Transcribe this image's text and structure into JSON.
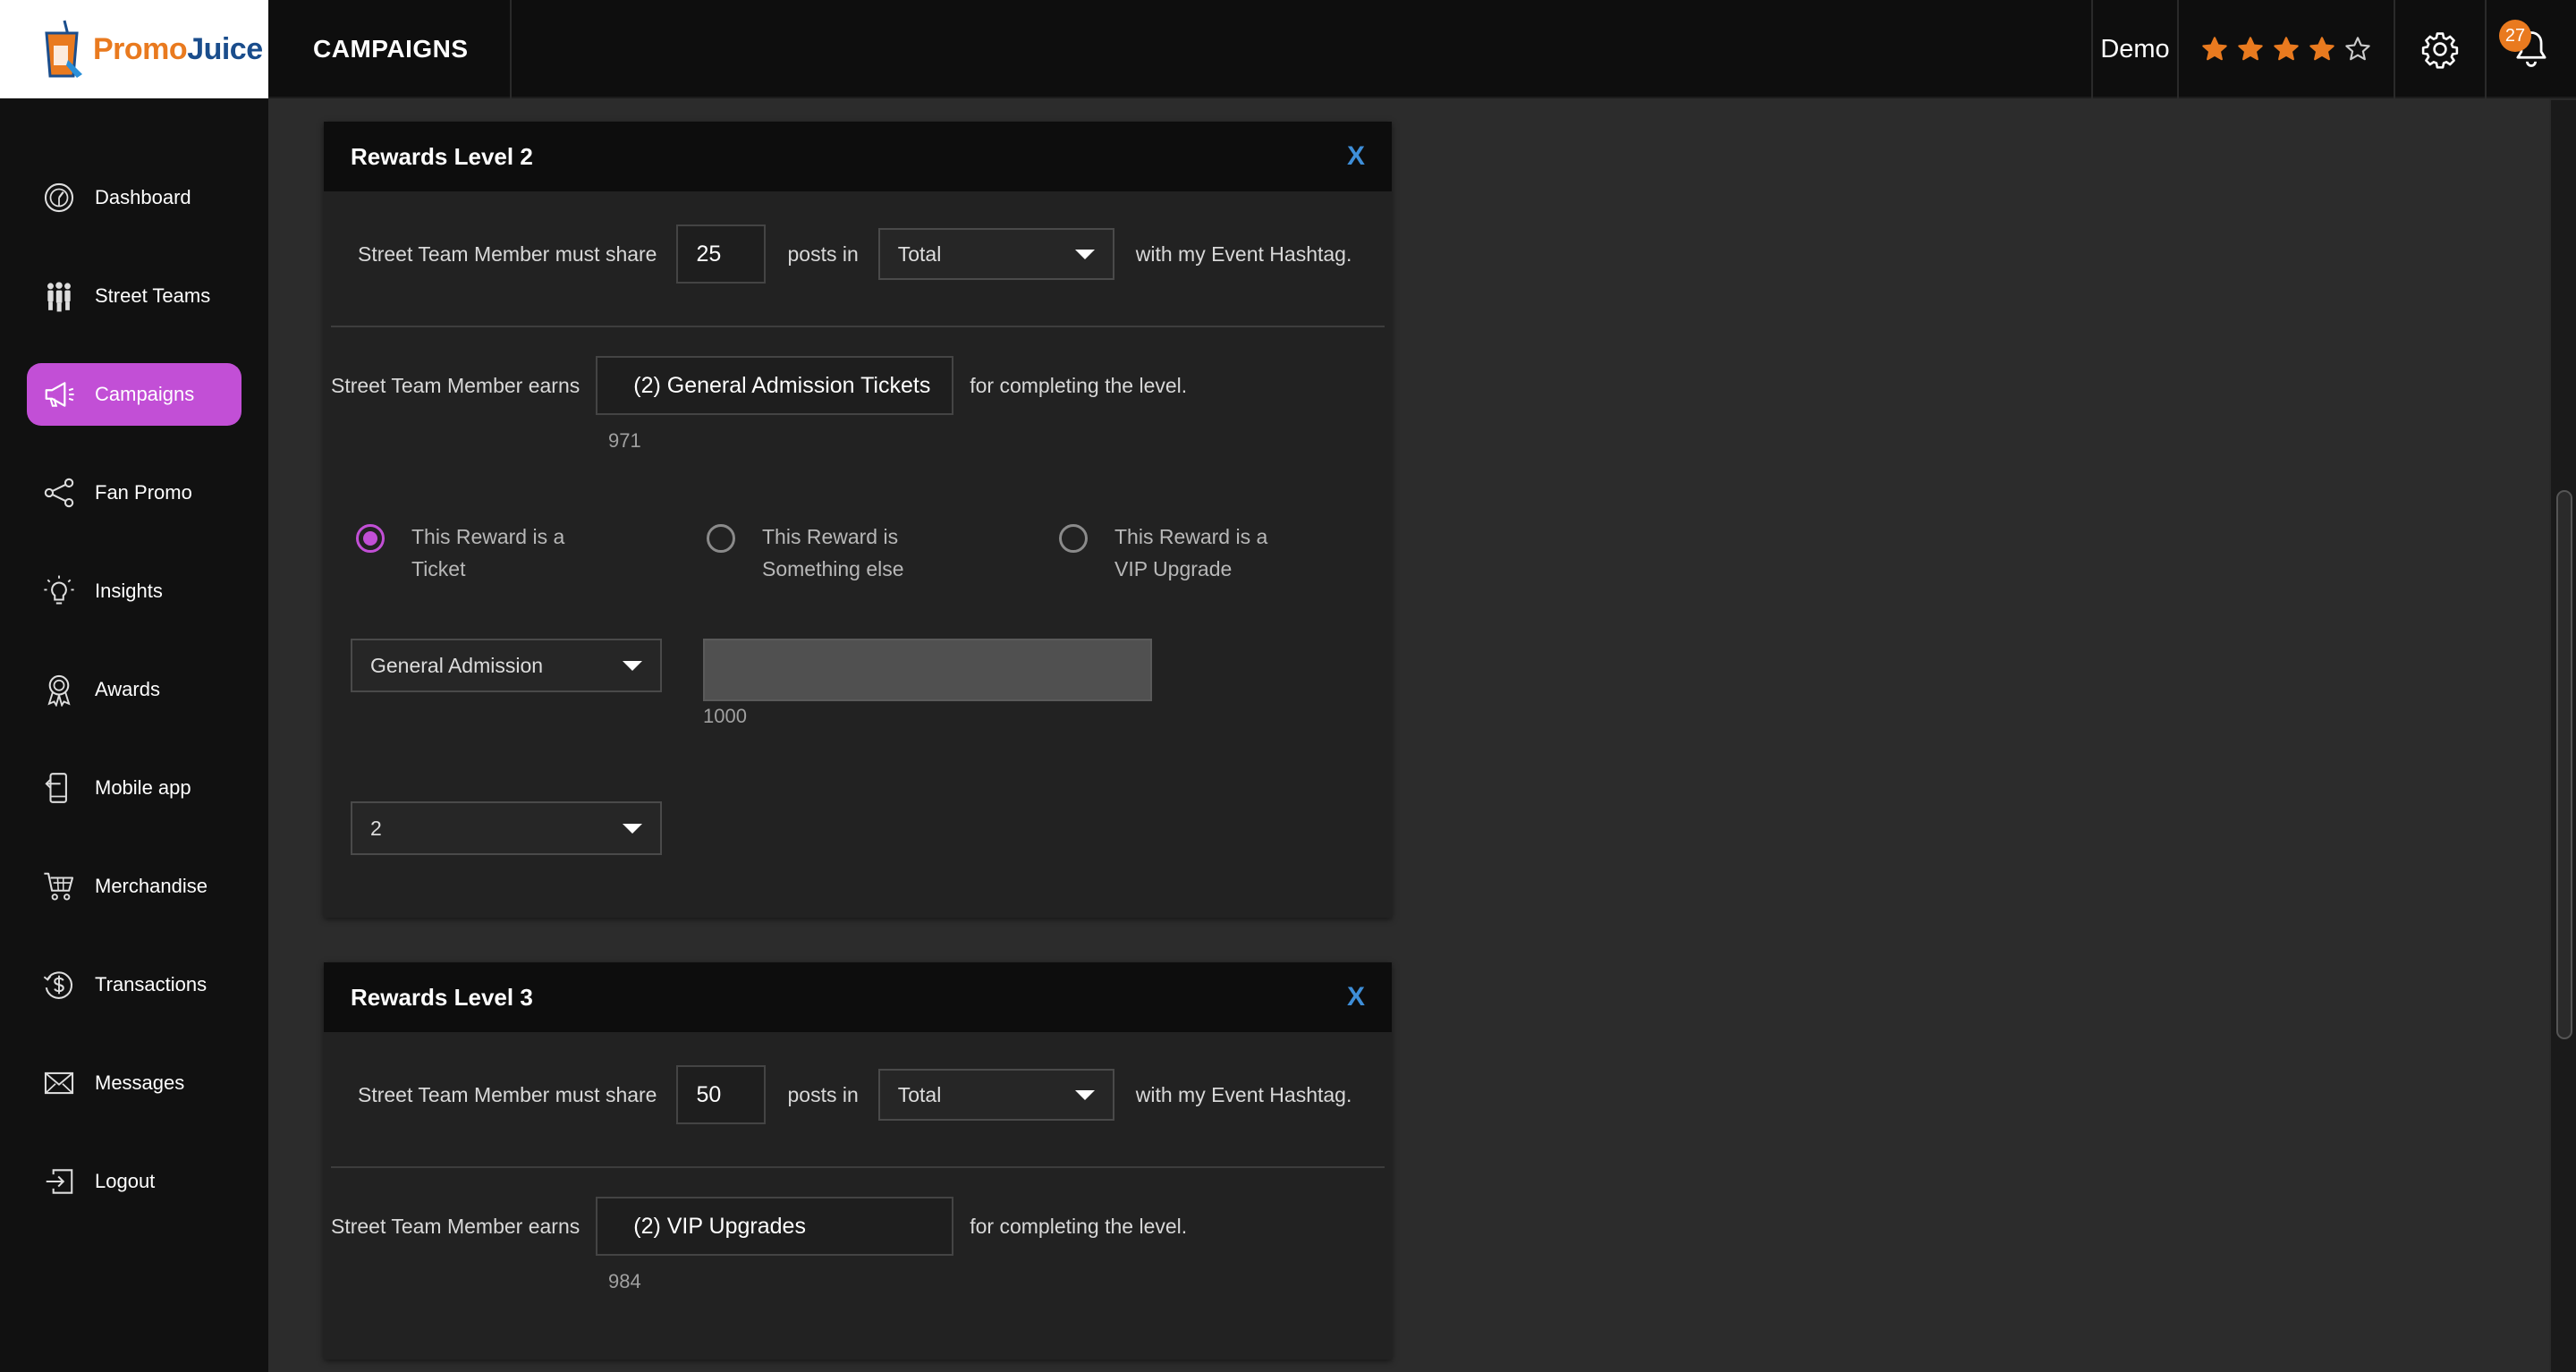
{
  "brand": {
    "name_part1": "Promo",
    "name_part2": "Juice"
  },
  "header": {
    "page_title": "CAMPAIGNS",
    "user_name": "Demo",
    "rating": {
      "value": 4,
      "max": 5
    },
    "notifications_count": "27",
    "accent_color": "#e97a1f"
  },
  "sidebar": {
    "active_color": "#c24fd6",
    "items": [
      {
        "label": "Dashboard",
        "icon": "dashboard-icon",
        "active": false
      },
      {
        "label": "Street Teams",
        "icon": "people-icon",
        "active": false
      },
      {
        "label": "Campaigns",
        "icon": "megaphone-icon",
        "active": true
      },
      {
        "label": "Fan Promo",
        "icon": "share-icon",
        "active": false
      },
      {
        "label": "Insights",
        "icon": "lightbulb-icon",
        "active": false
      },
      {
        "label": "Awards",
        "icon": "award-icon",
        "active": false
      },
      {
        "label": "Mobile app",
        "icon": "mobile-icon",
        "active": false
      },
      {
        "label": "Merchandise",
        "icon": "cart-icon",
        "active": false
      },
      {
        "label": "Transactions",
        "icon": "dollar-icon",
        "active": false
      },
      {
        "label": "Messages",
        "icon": "mail-icon",
        "active": false
      },
      {
        "label": "Logout",
        "icon": "logout-icon",
        "active": false
      }
    ]
  },
  "levels": [
    {
      "title": "Rewards Level 2",
      "close_label": "X",
      "share_prefix": "Street Team Member must share",
      "share_count": "25",
      "posts_in": "posts in",
      "period": "Total",
      "share_suffix": "with my Event Hashtag.",
      "earns_prefix": "Street Team Member earns",
      "reward_value": "(2) General Admission Tickets",
      "earns_suffix": "for completing the level.",
      "reward_counter": "971",
      "radio_options": [
        {
          "label": "This Reward is a Ticket",
          "checked": true
        },
        {
          "label": "This Reward is Something else",
          "checked": false
        },
        {
          "label": "This Reward is a VIP Upgrade",
          "checked": false
        }
      ],
      "ticket_type": "General Admission",
      "ticket_counter": "1000",
      "quantity": "2"
    },
    {
      "title": "Rewards Level 3",
      "close_label": "X",
      "share_prefix": "Street Team Member must share",
      "share_count": "50",
      "posts_in": "posts in",
      "period": "Total",
      "share_suffix": "with my Event Hashtag.",
      "earns_prefix": "Street Team Member earns",
      "reward_value": "(2) VIP Upgrades",
      "earns_suffix": "for completing the level.",
      "reward_counter": "984"
    }
  ]
}
